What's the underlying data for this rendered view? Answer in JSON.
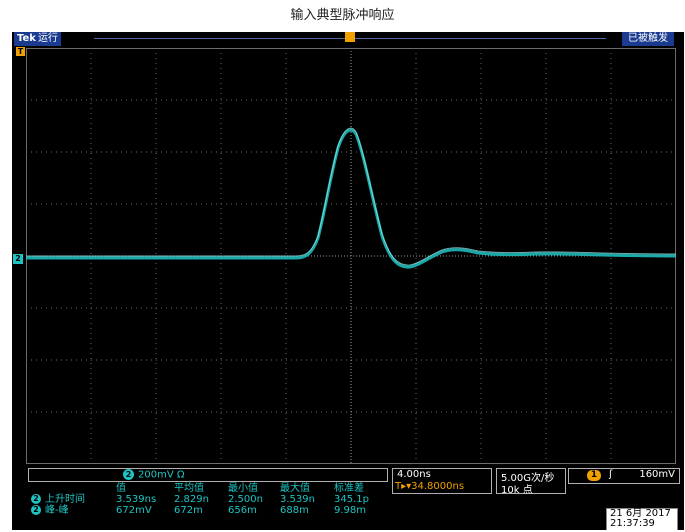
{
  "caption": "输入典型脉冲响应",
  "header": {
    "brand": "Tek",
    "run_state": "运行",
    "trigger_status": "已被触发"
  },
  "markers": {
    "trigger_marker": "T",
    "channel_marker": "2"
  },
  "channel_panel": {
    "channel": "2",
    "scale": "200mV Ω"
  },
  "measurements": {
    "headers": [
      "值",
      "平均值",
      "最小值",
      "最大值",
      "标准差"
    ],
    "rows": [
      {
        "channel": "2",
        "name": "上升时间",
        "values": [
          "3.539ns",
          "2.829n",
          "2.500n",
          "3.539n",
          "345.1p"
        ]
      },
      {
        "channel": "2",
        "name": "峰-峰",
        "values": [
          "672mV",
          "672m",
          "656m",
          "688m",
          "9.98m"
        ]
      }
    ]
  },
  "horizontal": {
    "scale": "4.00ns",
    "position": "T▸▾34.8000ns"
  },
  "acquisition": {
    "sample_rate": "5.00G次/秒",
    "record_length": "10k 点"
  },
  "trigger": {
    "source": "1",
    "slope": "ʃ",
    "level": "160mV"
  },
  "clock": {
    "date": "21 6月 2017",
    "time": "21:37:39"
  },
  "colors": {
    "trace": "#1ec4c4",
    "trigger": "#f0a000",
    "header": "#1a3b8f"
  }
}
